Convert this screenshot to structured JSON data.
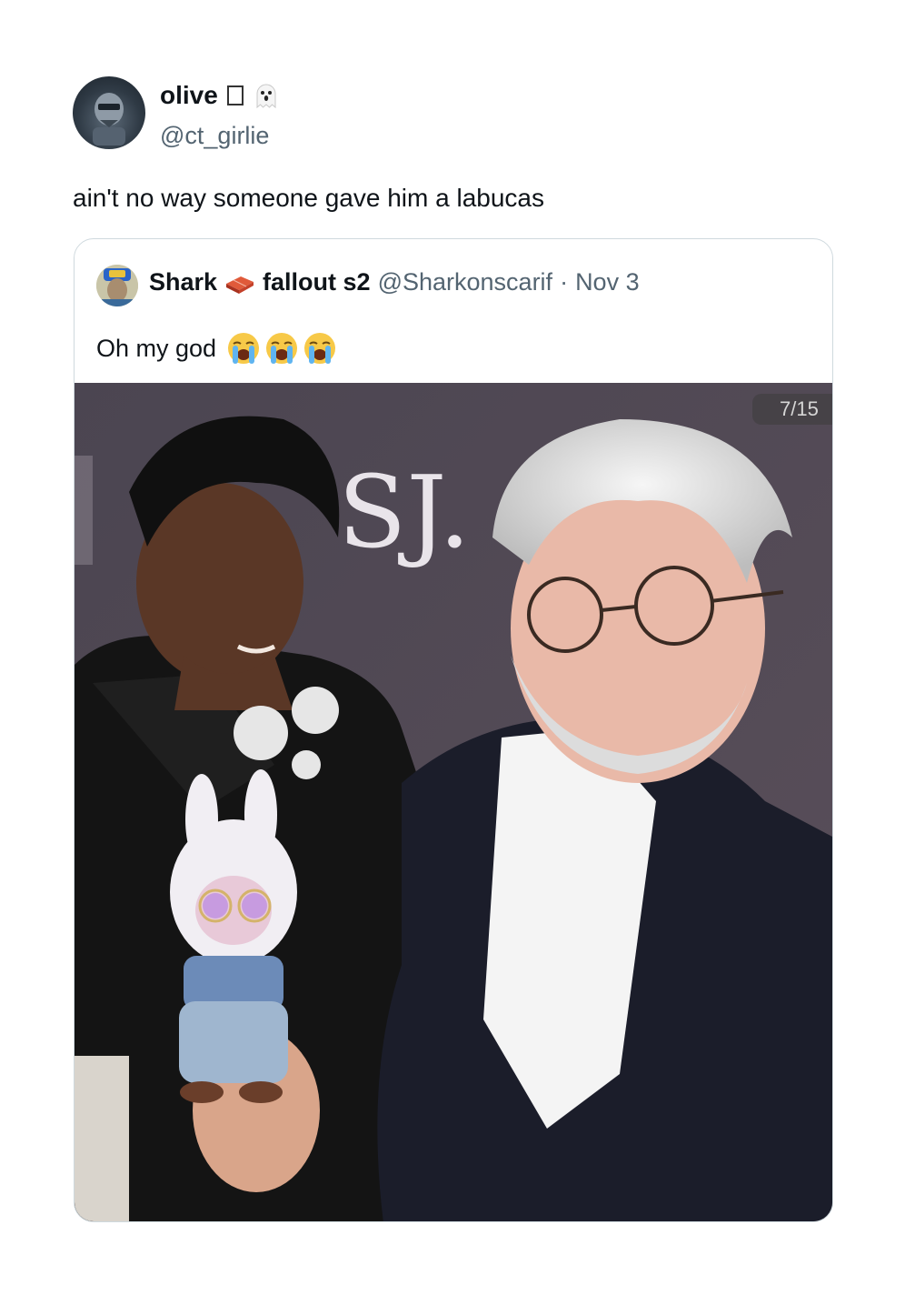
{
  "author": {
    "display_name": "olive",
    "handle": "@ct_girlie",
    "name_emoji_icons": [
      "box-glyph-icon",
      "ghost-icon"
    ]
  },
  "tweet": {
    "text": "ain't no way someone gave him a labucas"
  },
  "quoted": {
    "display_name": "Shark",
    "name_icon": "brick-icon",
    "name_suffix": "fallout s2",
    "handle": "@Sharkonscarif",
    "separator": "·",
    "date": "Nov 3",
    "text": "Oh my god",
    "emoji_icons": [
      "crying-face-icon",
      "crying-face-icon",
      "crying-face-icon"
    ],
    "media": {
      "counter": "7/15",
      "backdrop_logo": "SJ."
    }
  },
  "colors": {
    "text_primary": "#0f1419",
    "text_secondary": "#536471",
    "border": "#cfd9de",
    "backdrop": "#4a4550"
  }
}
